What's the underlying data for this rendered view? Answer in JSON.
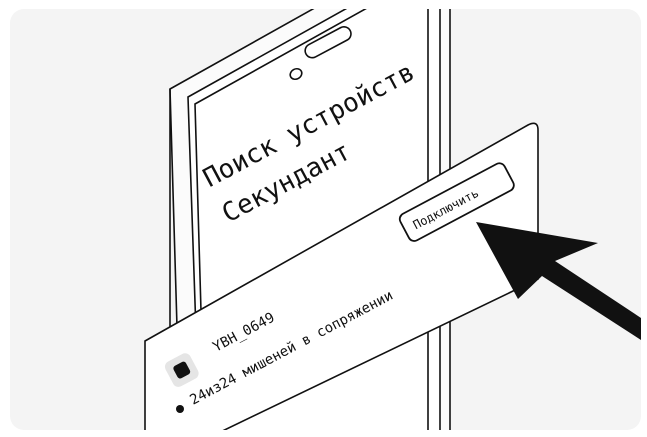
{
  "phone": {
    "title_line1": "Поиск устройств",
    "title_line2": "Секундант"
  },
  "device_card": {
    "connect_label": "Подключить",
    "device_name": "YBH_0649",
    "status_text": "24из24 мишеней в сопряжении",
    "status_color": "#111111",
    "icon": "device-square-icon"
  },
  "pointer": {
    "icon": "arrow-pointer-icon",
    "color": "#111111"
  },
  "colors": {
    "background": "#f4f4f4",
    "card": "#ffffff",
    "line": "#111111"
  }
}
